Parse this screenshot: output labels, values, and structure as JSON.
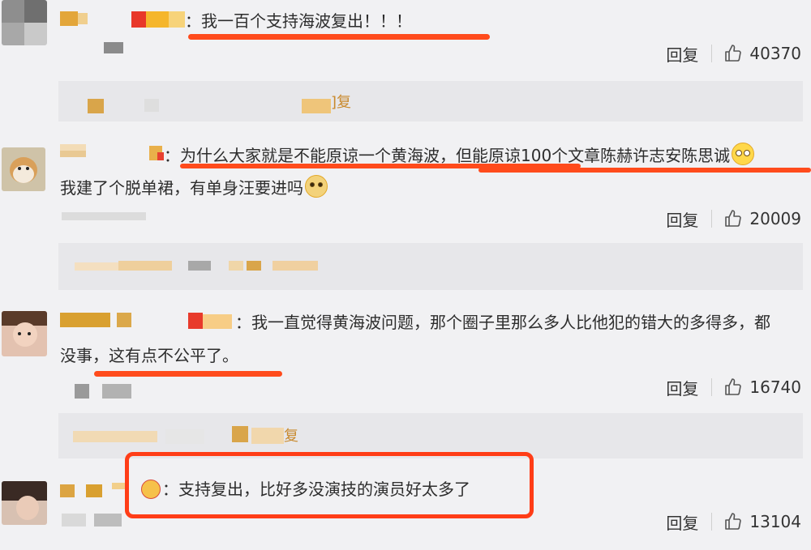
{
  "reply_label": "回复",
  "comments": [
    {
      "text": "：我一百个支持海波复出！！！",
      "likes": "40370"
    },
    {
      "text": "：为什么大家就是不能原谅一个黄海波，但能原谅100个文章陈赫许志安陈思诚",
      "text2": "我建了个脱单裙，有单身汪要进吗",
      "likes": "20009"
    },
    {
      "text": "：我一直觉得黄海波问题，那个圈子里那么多人比他犯的错大的多得多，都",
      "text2": "没事，这有点不公平了。",
      "likes": "16740"
    },
    {
      "text": "：支持复出，比好多没演技的演员好太多了",
      "likes": "13104"
    }
  ],
  "sub_fragments": [
    "]复",
    "复"
  ],
  "colors": {
    "underline": "#ff4b1c",
    "highlight_box": "#ff3d17",
    "name_gold": "#e3a63a"
  }
}
